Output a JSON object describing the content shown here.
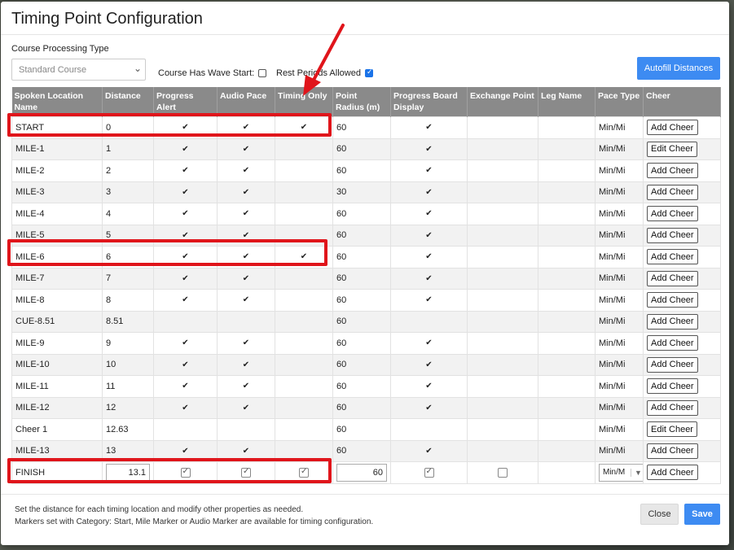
{
  "modal": {
    "title": "Timing Point Configuration"
  },
  "course": {
    "label": "Course Processing Type",
    "selected": "Standard Course"
  },
  "options": {
    "wave_start_label": "Course Has Wave Start:",
    "wave_start_checked": false,
    "rest_periods_label": "Rest Periods Allowed",
    "rest_periods_checked": true
  },
  "autofill_label": "Autofill Distances",
  "columns": [
    "Spoken Location Name",
    "Distance",
    "Progress Alert",
    "Audio Pace",
    "Timing Only",
    "Point Radius (m)",
    "Progress Board Display",
    "Exchange Point",
    "Leg Name",
    "Pace Type",
    "Cheer"
  ],
  "rows": [
    {
      "name": "START",
      "distance": "0",
      "progress_alert": true,
      "audio_pace": true,
      "timing_only": true,
      "radius": "60",
      "board": true,
      "pace": "Min/Mi",
      "cheer": "Add Cheer"
    },
    {
      "name": "MILE-1",
      "distance": "1",
      "progress_alert": true,
      "audio_pace": true,
      "timing_only": false,
      "radius": "60",
      "board": true,
      "pace": "Min/Mi",
      "cheer": "Edit Cheer"
    },
    {
      "name": "MILE-2",
      "distance": "2",
      "progress_alert": true,
      "audio_pace": true,
      "timing_only": false,
      "radius": "60",
      "board": true,
      "pace": "Min/Mi",
      "cheer": "Add Cheer"
    },
    {
      "name": "MILE-3",
      "distance": "3",
      "progress_alert": true,
      "audio_pace": true,
      "timing_only": false,
      "radius": "30",
      "board": true,
      "pace": "Min/Mi",
      "cheer": "Add Cheer"
    },
    {
      "name": "MILE-4",
      "distance": "4",
      "progress_alert": true,
      "audio_pace": true,
      "timing_only": false,
      "radius": "60",
      "board": true,
      "pace": "Min/Mi",
      "cheer": "Add Cheer"
    },
    {
      "name": "MILE-5",
      "distance": "5",
      "progress_alert": true,
      "audio_pace": true,
      "timing_only": false,
      "radius": "60",
      "board": true,
      "pace": "Min/Mi",
      "cheer": "Add Cheer"
    },
    {
      "name": "MILE-6",
      "distance": "6",
      "progress_alert": true,
      "audio_pace": true,
      "timing_only": true,
      "radius": "60",
      "board": true,
      "pace": "Min/Mi",
      "cheer": "Add Cheer"
    },
    {
      "name": "MILE-7",
      "distance": "7",
      "progress_alert": true,
      "audio_pace": true,
      "timing_only": false,
      "radius": "60",
      "board": true,
      "pace": "Min/Mi",
      "cheer": "Add Cheer"
    },
    {
      "name": "MILE-8",
      "distance": "8",
      "progress_alert": true,
      "audio_pace": true,
      "timing_only": false,
      "radius": "60",
      "board": true,
      "pace": "Min/Mi",
      "cheer": "Add Cheer"
    },
    {
      "name": "CUE-8.51",
      "distance": "8.51",
      "progress_alert": false,
      "audio_pace": false,
      "timing_only": false,
      "radius": "60",
      "board": false,
      "pace": "Min/Mi",
      "cheer": "Add Cheer"
    },
    {
      "name": "MILE-9",
      "distance": "9",
      "progress_alert": true,
      "audio_pace": true,
      "timing_only": false,
      "radius": "60",
      "board": true,
      "pace": "Min/Mi",
      "cheer": "Add Cheer"
    },
    {
      "name": "MILE-10",
      "distance": "10",
      "progress_alert": true,
      "audio_pace": true,
      "timing_only": false,
      "radius": "60",
      "board": true,
      "pace": "Min/Mi",
      "cheer": "Add Cheer"
    },
    {
      "name": "MILE-11",
      "distance": "11",
      "progress_alert": true,
      "audio_pace": true,
      "timing_only": false,
      "radius": "60",
      "board": true,
      "pace": "Min/Mi",
      "cheer": "Add Cheer"
    },
    {
      "name": "MILE-12",
      "distance": "12",
      "progress_alert": true,
      "audio_pace": true,
      "timing_only": false,
      "radius": "60",
      "board": true,
      "pace": "Min/Mi",
      "cheer": "Add Cheer"
    },
    {
      "name": "Cheer 1",
      "distance": "12.63",
      "progress_alert": false,
      "audio_pace": false,
      "timing_only": false,
      "radius": "60",
      "board": false,
      "pace": "Min/Mi",
      "cheer": "Edit Cheer"
    },
    {
      "name": "MILE-13",
      "distance": "13",
      "progress_alert": true,
      "audio_pace": true,
      "timing_only": false,
      "radius": "60",
      "board": true,
      "pace": "Min/Mi",
      "cheer": "Add Cheer"
    }
  ],
  "finish_row": {
    "name": "FINISH",
    "distance": "13.1",
    "progress_alert": true,
    "audio_pace": true,
    "timing_only": true,
    "radius": "60",
    "board": true,
    "exchange": false,
    "pace": "Min/M",
    "cheer": "Add Cheer"
  },
  "footer": {
    "line1": "Set the distance for each timing location and modify other properties as needed.",
    "line2": "Markers set with Category: Start, Mile Marker or Audio Marker are available for timing configuration.",
    "close_label": "Close",
    "save_label": "Save"
  },
  "annotation_color": "#e0151b"
}
